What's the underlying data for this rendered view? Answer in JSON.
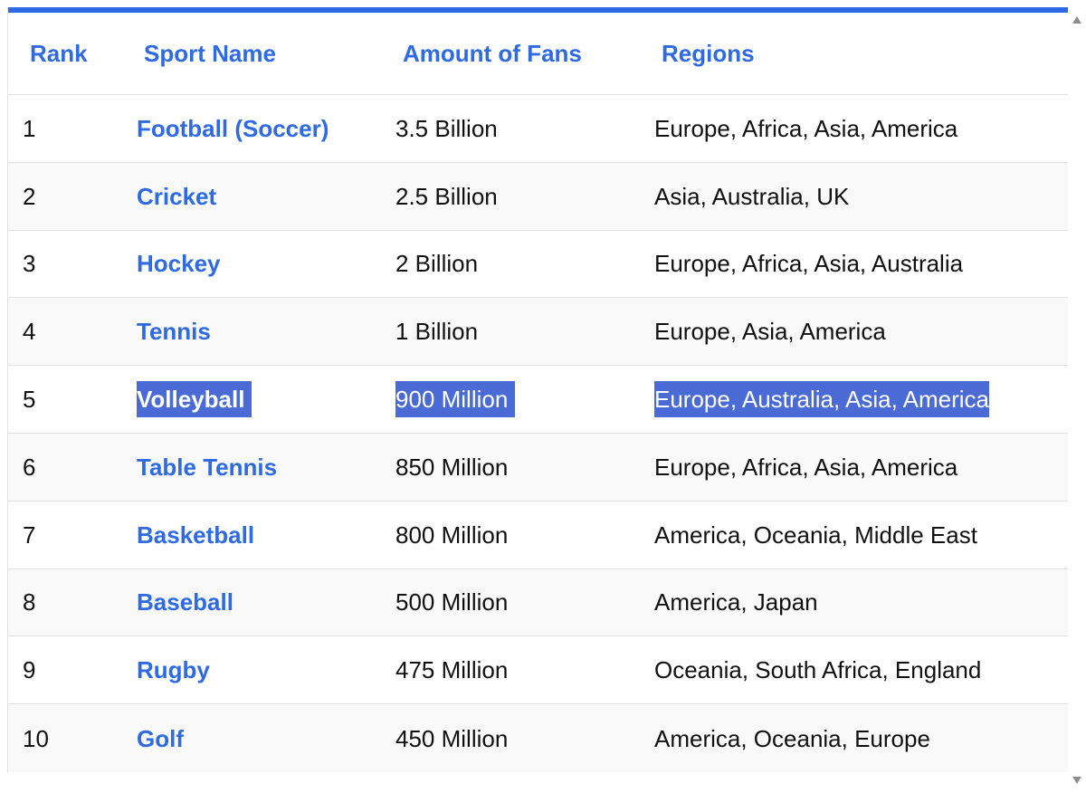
{
  "table": {
    "headers": {
      "rank": "Rank",
      "sport": "Sport Name",
      "fans": "Amount of Fans",
      "regions": "Regions"
    },
    "rows": [
      {
        "rank": "1",
        "sport": "Football (Soccer)",
        "fans": "3.5 Billion",
        "regions": "Europe, Africa, Asia, America"
      },
      {
        "rank": "2",
        "sport": "Cricket",
        "fans": "2.5 Billion",
        "regions": "Asia, Australia, UK"
      },
      {
        "rank": "3",
        "sport": "Hockey",
        "fans": "2 Billion",
        "regions": "Europe, Africa, Asia, Australia"
      },
      {
        "rank": "4",
        "sport": "Tennis",
        "fans": "1 Billion",
        "regions": "Europe, Asia, America"
      },
      {
        "rank": "5",
        "sport": "Volleyball",
        "fans": "900 Million",
        "regions": "Europe, Australia, Asia, America"
      },
      {
        "rank": "6",
        "sport": "Table Tennis",
        "fans": "850 Million",
        "regions": "Europe, Africa, Asia, America"
      },
      {
        "rank": "7",
        "sport": "Basketball",
        "fans": "800 Million",
        "regions": "America, Oceania, Middle East"
      },
      {
        "rank": "8",
        "sport": "Baseball",
        "fans": "500 Million",
        "regions": "America, Japan"
      },
      {
        "rank": "9",
        "sport": "Rugby",
        "fans": "475 Million",
        "regions": "Oceania, South Africa, England"
      },
      {
        "rank": "10",
        "sport": "Golf",
        "fans": "450 Million",
        "regions": "America, Oceania, Europe"
      }
    ],
    "selected_row_index": 4
  },
  "colors": {
    "accent": "#2d6ae3",
    "selection": "#4a6bd6",
    "text": "#111111"
  },
  "icons": {
    "scroll_up": "scroll-up-arrow-icon",
    "scroll_down": "scroll-down-arrow-icon"
  }
}
